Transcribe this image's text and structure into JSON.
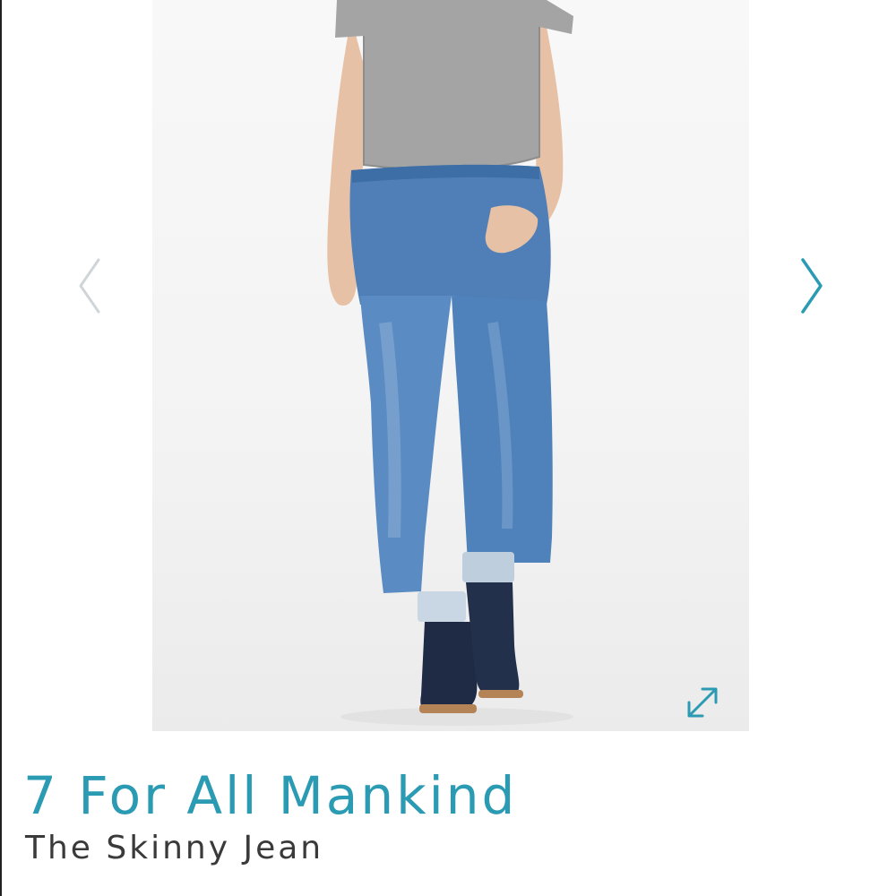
{
  "product": {
    "brand": "7 For All Mankind",
    "name": "The Skinny Jean"
  },
  "gallery": {
    "image_subject": "model-wearing-skinny-jeans-photo",
    "prev_icon": "chevron-left-icon",
    "next_icon": "chevron-right-icon",
    "expand_icon": "expand-arrows-icon"
  },
  "colors": {
    "accent": "#2a9bb3",
    "product_name": "#3a3a3a",
    "prev_arrow": "#cfd6d8",
    "next_arrow": "#2a9bb3"
  }
}
